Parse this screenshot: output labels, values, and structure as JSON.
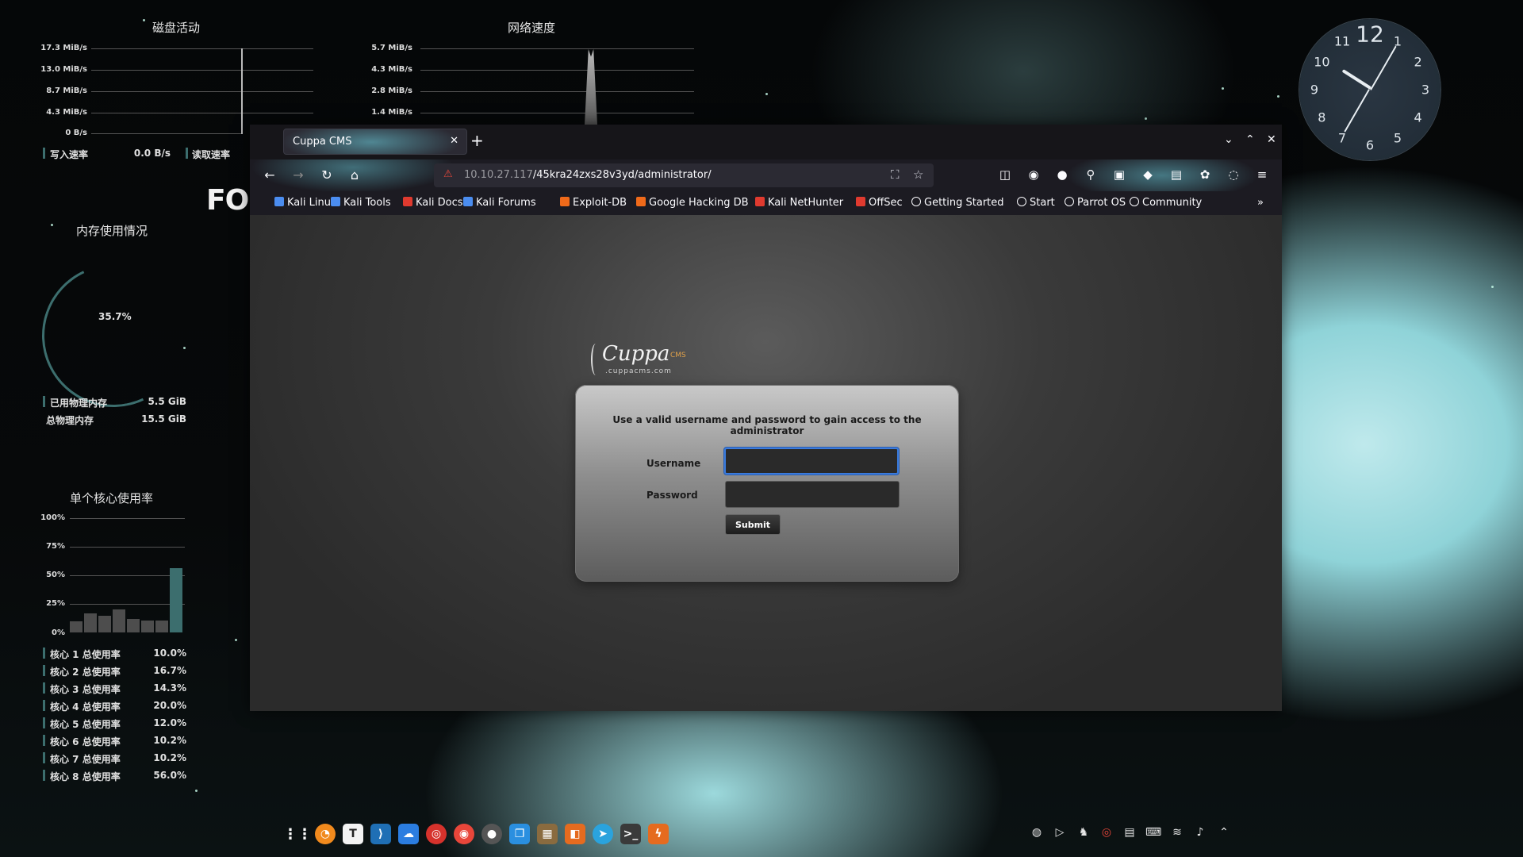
{
  "colors": {
    "accent": "#3b7bdc",
    "conky_bar": "#3c6e6e",
    "url_lock": "#e0463b"
  },
  "disk_widget": {
    "title": "磁盘活动",
    "y_labels": [
      "17.3 MiB/s",
      "13.0 MiB/s",
      "8.7 MiB/s",
      "4.3 MiB/s",
      "0 B/s"
    ],
    "write_label": "写入速率",
    "write_value": "0.0 B/s",
    "read_label": "读取速率"
  },
  "net_widget": {
    "title": "网络速度",
    "y_labels": [
      "5.7 MiB/s",
      "4.3 MiB/s",
      "2.8 MiB/s",
      "1.4 MiB/s"
    ]
  },
  "memory_widget": {
    "title": "内存使用情况",
    "percent": "35.7%",
    "percent_value": 35.7,
    "used_label": "已用物理内存",
    "used_value": "5.5 GiB",
    "total_label": "总物理内存",
    "total_value": "15.5 GiB"
  },
  "cpu_widget": {
    "title": "单个核心使用率",
    "y_labels": [
      "100%",
      "75%",
      "50%",
      "25%",
      "0%"
    ],
    "cores": [
      {
        "label": "核心 1 总使用率",
        "value": "10.0%",
        "pct": 10.0
      },
      {
        "label": "核心 2 总使用率",
        "value": "16.7%",
        "pct": 16.7
      },
      {
        "label": "核心 3 总使用率",
        "value": "14.3%",
        "pct": 14.3
      },
      {
        "label": "核心 4 总使用率",
        "value": "20.0%",
        "pct": 20.0
      },
      {
        "label": "核心 5 总使用率",
        "value": "12.0%",
        "pct": 12.0
      },
      {
        "label": "核心 6 总使用率",
        "value": "10.2%",
        "pct": 10.2
      },
      {
        "label": "核心 7 总使用率",
        "value": "10.2%",
        "pct": 10.2
      },
      {
        "label": "核心 8 总使用率",
        "value": "56.0%",
        "pct": 56.0
      }
    ]
  },
  "desktop_text": "FO",
  "clock": {
    "numbers": [
      "12",
      "1",
      "2",
      "3",
      "4",
      "5",
      "6",
      "7",
      "8",
      "9",
      "10",
      "11"
    ],
    "hour": 10,
    "minute": 5
  },
  "browser": {
    "tab_title": "Cuppa CMS",
    "url_host": "10.10.27.117",
    "url_path": "/45kra24zxs28v3yd/administrator/",
    "bookmarks": [
      {
        "label": "Kali Linux",
        "icon": "kali-icon",
        "color": "#4b8df0"
      },
      {
        "label": "Kali Tools",
        "icon": "kali-tools-icon",
        "color": "#4b8df0"
      },
      {
        "label": "Kali Docs",
        "icon": "kali-docs-icon",
        "color": "#e03a2f"
      },
      {
        "label": "Kali Forums",
        "icon": "kali-forums-icon",
        "color": "#4b8df0"
      },
      {
        "label": "Exploit-DB",
        "icon": "exploit-db-icon",
        "color": "#f06a1a"
      },
      {
        "label": "Google Hacking DB",
        "icon": "ghdb-icon",
        "color": "#f06a1a"
      },
      {
        "label": "Kali NetHunter",
        "icon": "nethunter-icon",
        "color": "#e03a2f"
      },
      {
        "label": "OffSec",
        "icon": "offsec-icon",
        "color": "#e03a2f"
      },
      {
        "label": "Getting Started",
        "icon": "globe-icon",
        "color": ""
      },
      {
        "label": "Start",
        "icon": "globe-icon",
        "color": ""
      },
      {
        "label": "Parrot OS",
        "icon": "globe-icon",
        "color": ""
      },
      {
        "label": "Community",
        "icon": "globe-icon",
        "color": ""
      }
    ]
  },
  "login": {
    "logo_text": "Cuppa",
    "logo_cms": "CMS",
    "logo_sub": ".cuppacms.com",
    "message": "Use a valid username and password to gain access to the administrator",
    "username_label": "Username",
    "username_value": "",
    "password_label": "Password",
    "password_value": "",
    "submit_label": "Submit"
  }
}
